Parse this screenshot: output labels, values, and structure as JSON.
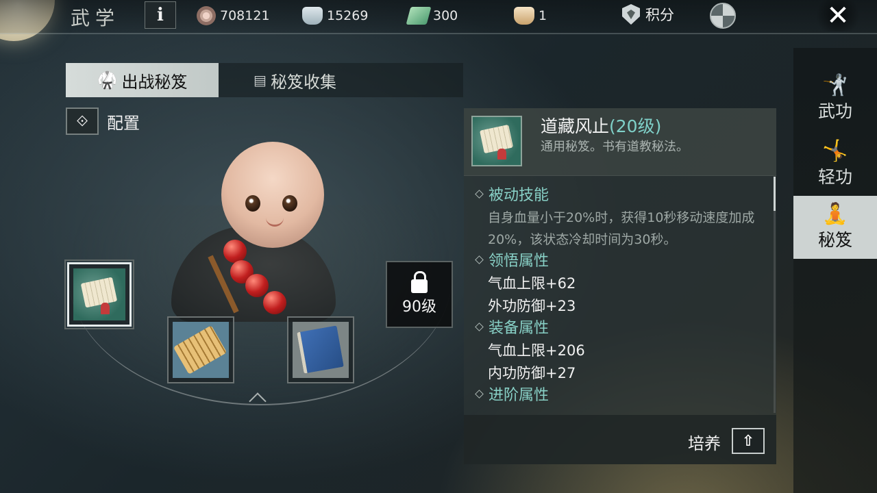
{
  "header": {
    "title": "武学",
    "info_label": "i",
    "currencies": [
      {
        "icon": "copper-coin-icon",
        "value": "708121"
      },
      {
        "icon": "silver-ingot-icon",
        "value": "15269"
      },
      {
        "icon": "jade-ticket-icon",
        "value": "300"
      },
      {
        "icon": "gold-ingot-icon",
        "value": "1"
      }
    ],
    "score_label": "积分",
    "close_label": "✕"
  },
  "tabs": [
    {
      "label": "出战秘笈",
      "icon": "martial-pose-icon",
      "active": true
    },
    {
      "label": "秘笈收集",
      "icon": "scroll-icon",
      "active": false
    }
  ],
  "config": {
    "label": "配置"
  },
  "slots": {
    "locked_level": "90级"
  },
  "detail": {
    "name": "道藏风止",
    "level": "(20级)",
    "desc": "通用秘笈。书有道教秘法。",
    "sections": [
      {
        "title": "被动技能",
        "text": "自身血量小于20%时，获得10秒移动速度加成20%，该状态冷却时间为30秒。"
      },
      {
        "title": "领悟属性",
        "attrs": [
          "气血上限+62",
          "外功防御+23"
        ]
      },
      {
        "title": "装备属性",
        "attrs": [
          "气血上限+206",
          "内功防御+27"
        ]
      },
      {
        "title": "进阶属性"
      }
    ],
    "cultivate_label": "培养",
    "cultivate_icon": "⇧"
  },
  "sidebar": [
    {
      "label": "武功",
      "icon": "kick-pose-icon",
      "active": false
    },
    {
      "label": "轻功",
      "icon": "leap-pose-icon",
      "active": false
    },
    {
      "label": "秘笈",
      "icon": "meditation-icon",
      "active": true
    }
  ],
  "colors": {
    "accent_teal": "#88d0c6",
    "level_teal": "#7fd0c8"
  }
}
